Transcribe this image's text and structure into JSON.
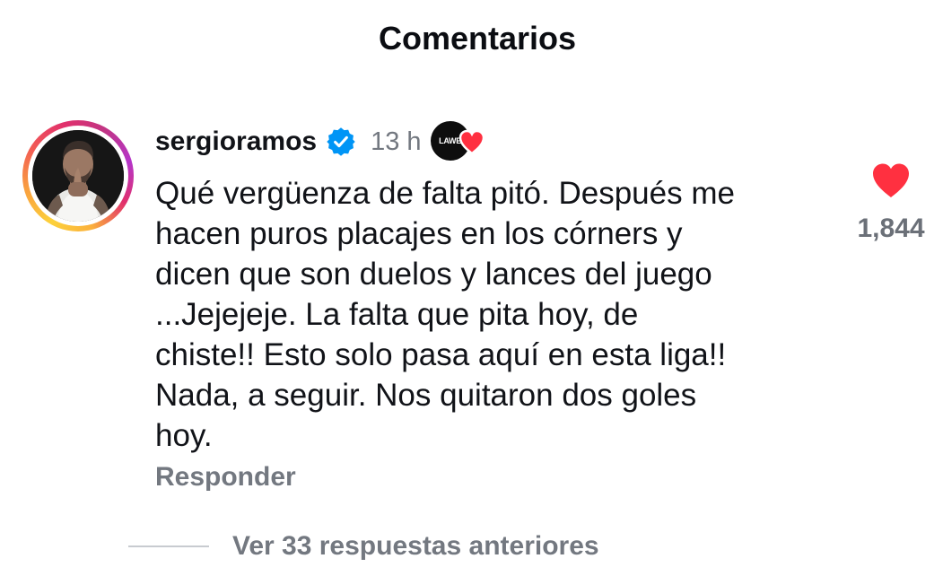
{
  "header": {
    "title": "Comentarios"
  },
  "comment": {
    "username": "sergioramos",
    "verified": true,
    "time": "13 h",
    "liked_by_label": "LAWE",
    "text": "Qué vergüenza de falta pitó. Después me\nhacen puros placajes en los córners y\ndicen que son duelos y lances del juego\n...Jejejeje. La falta que pita hoy, de\nchiste!! Esto solo pasa aquí en esta liga!!\nNada, a seguir. Nos quitaron dos goles\nhoy.",
    "reply_label": "Responder",
    "like_count": "1,844"
  },
  "replies": {
    "view_label": "Ver 33 respuestas anteriores"
  },
  "icons": {
    "verified": "verified-badge-icon",
    "like": "heart-icon",
    "liked_by_heart": "heart-icon"
  },
  "colors": {
    "verified_blue": "#0095f6",
    "heart_red": "#ff3040",
    "muted_text": "#737880"
  }
}
